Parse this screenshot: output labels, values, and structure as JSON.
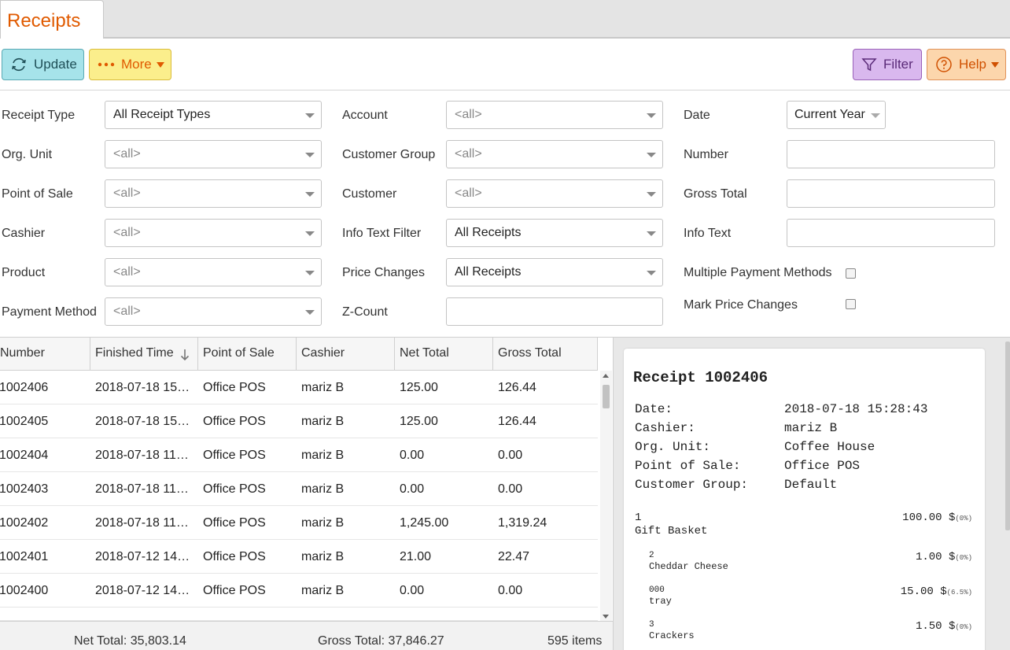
{
  "tab": {
    "title": "Receipts"
  },
  "toolbar": {
    "update": "Update",
    "more": "More",
    "filter": "Filter",
    "help": "Help"
  },
  "filters": {
    "receipt_type": {
      "label": "Receipt Type",
      "value": "All Receipt Types"
    },
    "org_unit": {
      "label": "Org. Unit",
      "value": "<all>"
    },
    "point_of_sale": {
      "label": "Point of Sale",
      "value": "<all>"
    },
    "cashier": {
      "label": "Cashier",
      "value": "<all>"
    },
    "product": {
      "label": "Product",
      "value": "<all>"
    },
    "payment_method": {
      "label": "Payment Method",
      "value": "<all>"
    },
    "account": {
      "label": "Account",
      "value": "<all>"
    },
    "customer_group": {
      "label": "Customer Group",
      "value": "<all>"
    },
    "customer": {
      "label": "Customer",
      "value": "<all>"
    },
    "info_text_filter": {
      "label": "Info Text Filter",
      "value": "All Receipts"
    },
    "price_changes": {
      "label": "Price Changes",
      "value": "All Receipts"
    },
    "z_count": {
      "label": "Z-Count",
      "value": ""
    },
    "date": {
      "label": "Date",
      "value": "Current Year"
    },
    "number": {
      "label": "Number",
      "value": ""
    },
    "gross_total": {
      "label": "Gross Total",
      "value": ""
    },
    "info_text": {
      "label": "Info Text",
      "value": ""
    },
    "multiple_payment_methods": {
      "label": "Multiple Payment Methods",
      "checked": false
    },
    "mark_price_changes": {
      "label": "Mark Price Changes",
      "checked": false
    }
  },
  "grid": {
    "columns": [
      "Number",
      "Finished Time",
      "Point of Sale",
      "Cashier",
      "Net Total",
      "Gross Total"
    ],
    "rows": [
      {
        "number": "1002406",
        "time": "2018-07-18 15…",
        "pos": "Office POS",
        "cashier": "mariz B",
        "net": "125.00",
        "gross": "126.44"
      },
      {
        "number": "1002405",
        "time": "2018-07-18 15…",
        "pos": "Office POS",
        "cashier": "mariz B",
        "net": "125.00",
        "gross": "126.44"
      },
      {
        "number": "1002404",
        "time": "2018-07-18 11…",
        "pos": "Office POS",
        "cashier": "mariz B",
        "net": "0.00",
        "gross": "0.00"
      },
      {
        "number": "1002403",
        "time": "2018-07-18 11…",
        "pos": "Office POS",
        "cashier": "mariz B",
        "net": "0.00",
        "gross": "0.00"
      },
      {
        "number": "1002402",
        "time": "2018-07-18 11…",
        "pos": "Office POS",
        "cashier": "mariz B",
        "net": "1,245.00",
        "gross": "1,319.24"
      },
      {
        "number": "1002401",
        "time": "2018-07-12 14…",
        "pos": "Office POS",
        "cashier": "mariz B",
        "net": "21.00",
        "gross": "22.47"
      },
      {
        "number": "1002400",
        "time": "2018-07-12 14…",
        "pos": "Office POS",
        "cashier": "mariz B",
        "net": "0.00",
        "gross": "0.00"
      }
    ],
    "footer": {
      "net_total": "Net Total: 35,803.14",
      "gross_total": "Gross Total: 37,846.27",
      "items": "595 items"
    }
  },
  "receipt": {
    "title": "Receipt 1002406",
    "fields": [
      {
        "label": "Date:",
        "value": "2018-07-18 15:28:43"
      },
      {
        "label": "Cashier:",
        "value": "mariz B"
      },
      {
        "label": "Org. Unit:",
        "value": "Coffee House"
      },
      {
        "label": "Point of Sale:",
        "value": "Office POS"
      },
      {
        "label": "Customer Group:",
        "value": "Default"
      }
    ],
    "lines": [
      {
        "qty": "1",
        "name": "Gift Basket",
        "price": "100.00 $",
        "tax": "(0%)"
      },
      {
        "qty": "2",
        "name": "Cheddar Cheese",
        "price": "1.00 $",
        "tax": "(0%)"
      },
      {
        "qty": "000",
        "name": "tray",
        "price": "15.00 $",
        "tax": "(6.5%)"
      },
      {
        "qty": "3",
        "name": "Crackers",
        "price": "1.50 $",
        "tax": "(0%)"
      }
    ]
  }
}
